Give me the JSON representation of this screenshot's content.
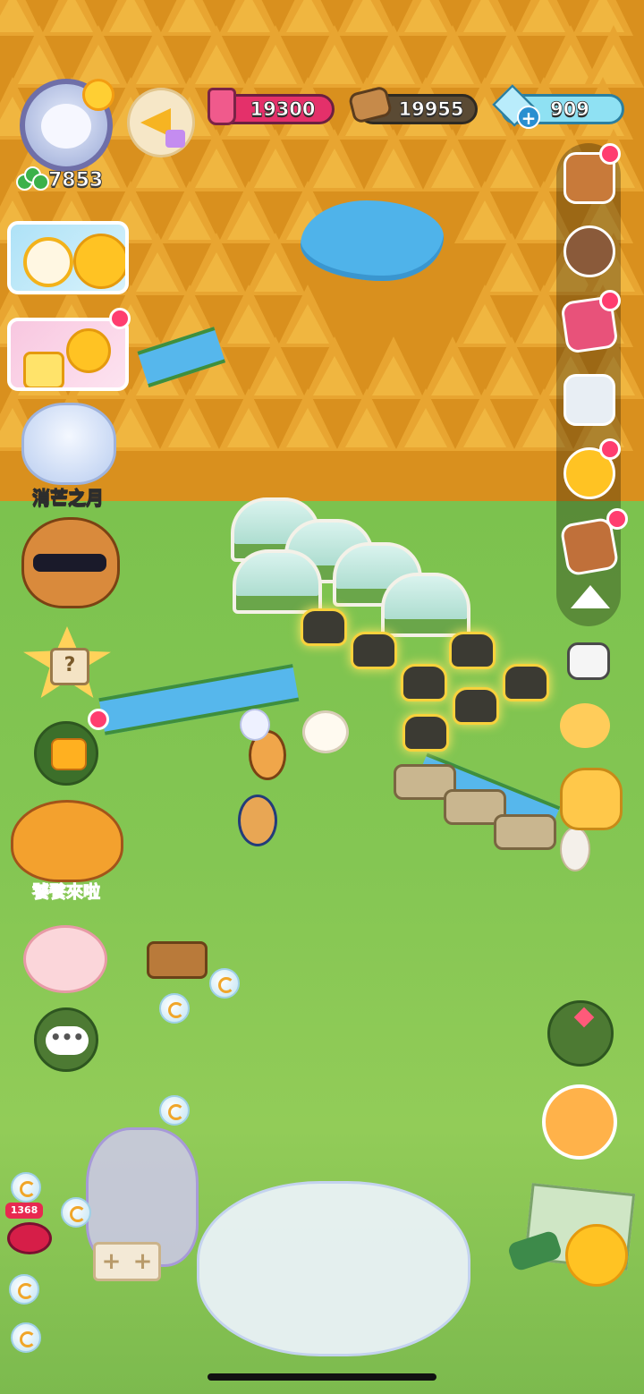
{
  "hud": {
    "clover_count": "7853",
    "resources": [
      {
        "name": "jam-jar",
        "value": "19300",
        "color": "#e4306a"
      },
      {
        "name": "wood-log",
        "value": "19955",
        "color": "#5a4a34"
      },
      {
        "name": "diamond",
        "value": "909",
        "color": "#8fe1f3"
      }
    ],
    "gem_add_symbol": "+"
  },
  "left_panel": {
    "moon_pet_label": "消芒之月",
    "event_label": "饕餮來啦",
    "mystery_symbol": "?",
    "chat_symbol": "•••"
  },
  "right_rail": {
    "items": [
      {
        "name": "shop-stall-icon",
        "has_notification": true
      },
      {
        "name": "cow-friend-icon",
        "has_notification": false
      },
      {
        "name": "cards-icon",
        "has_notification": true
      },
      {
        "name": "bread-phone-icon",
        "has_notification": false
      },
      {
        "name": "duck-chick-icon",
        "has_notification": true
      },
      {
        "name": "recipe-book-icon",
        "has_notification": true
      }
    ]
  },
  "bottom": {
    "jar_badge": "1368",
    "plus_tile": [
      "+",
      "+"
    ]
  },
  "colors": {
    "notification": "#ff3d6f",
    "grass": "#84c653",
    "autumn_tree": "#e8a531",
    "water": "#4fb3ea"
  }
}
